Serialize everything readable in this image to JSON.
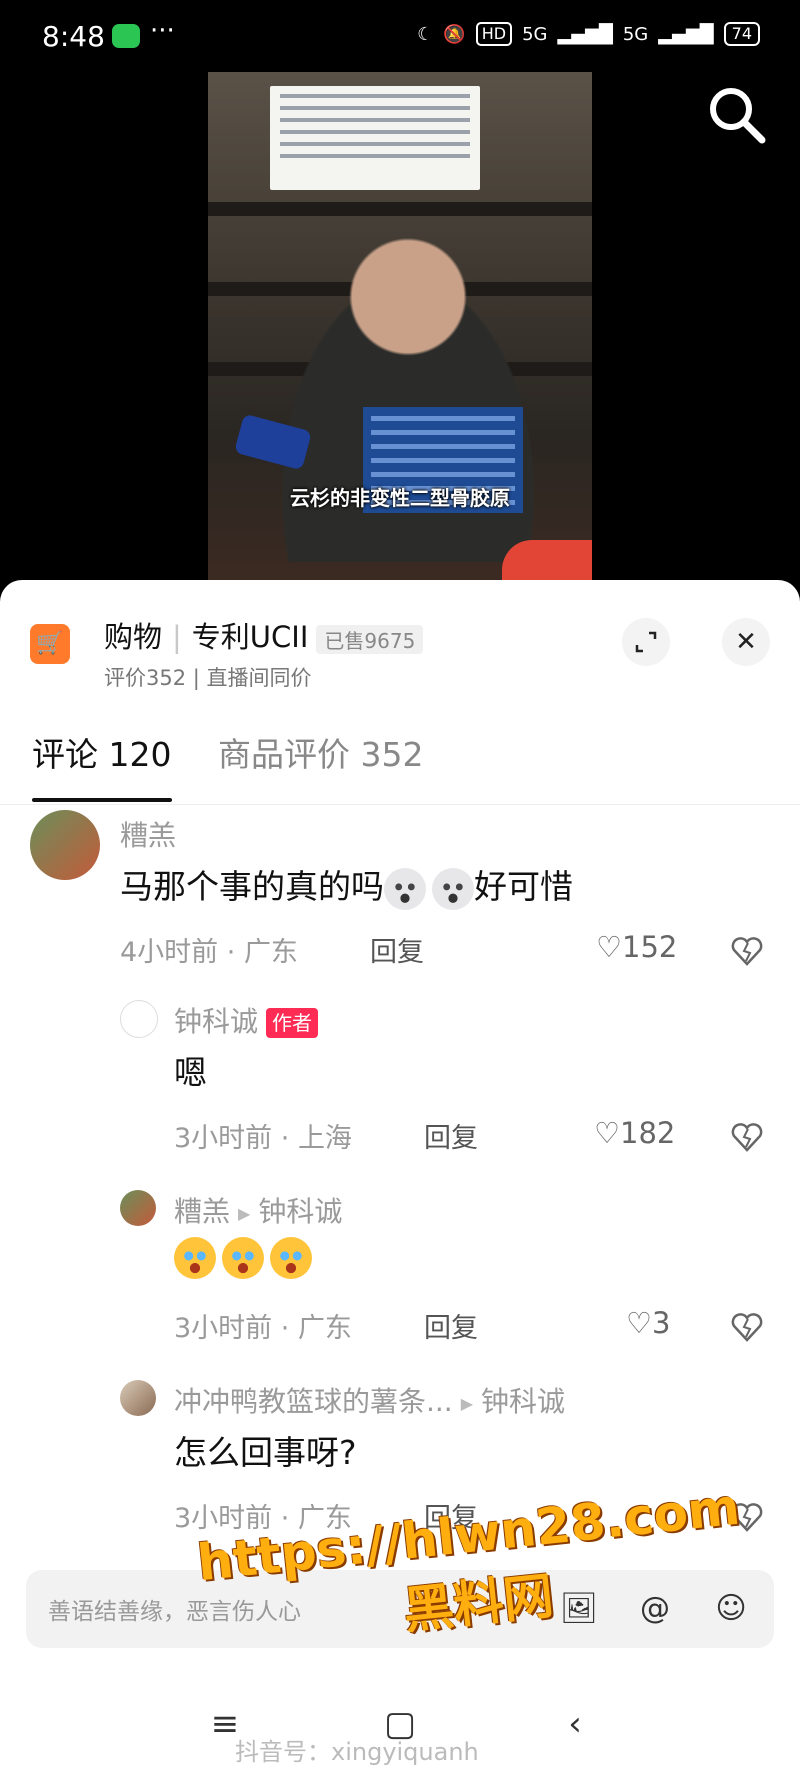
{
  "status_bar": {
    "time": "8:48",
    "dots": "···",
    "hd": "HD",
    "signal1": "5G",
    "signal2": "5G",
    "battery": "74"
  },
  "video": {
    "caption": "云杉的非变性二型骨胶原"
  },
  "product": {
    "category": "购物",
    "name": "专利UCII",
    "sold": "已售9675",
    "subtitle": "评价352 | 直播间同价"
  },
  "tabs": [
    {
      "label": "评论 120"
    },
    {
      "label": "商品评价 352"
    }
  ],
  "comments": [
    {
      "username": "糟羔",
      "text_before": "马那个事的真的吗",
      "text_after": "好可惜",
      "time": "4小时前",
      "location": "广东",
      "reply_label": "回复",
      "likes": "152"
    },
    {
      "username": "钟科诚",
      "badge": "作者",
      "text": "嗯",
      "time": "3小时前",
      "location": "上海",
      "reply_label": "回复",
      "likes": "182"
    },
    {
      "username": "糟羔",
      "reply_to": "钟科诚",
      "time": "3小时前",
      "location": "广东",
      "reply_label": "回复",
      "likes": "3"
    },
    {
      "username": "冲冲鸭教篮球的薯条...",
      "reply_to": "钟科诚",
      "text": "怎么回事呀?",
      "time": "3小时前",
      "location": "广东",
      "reply_label": "回复"
    }
  ],
  "input": {
    "placeholder": "善语结善缘，恶言伤人心"
  },
  "watermark": {
    "url": "https://hlwn28.com",
    "name": "黑料网"
  },
  "navbar": {
    "douyin_id": "抖音号：xingyiquanh"
  }
}
